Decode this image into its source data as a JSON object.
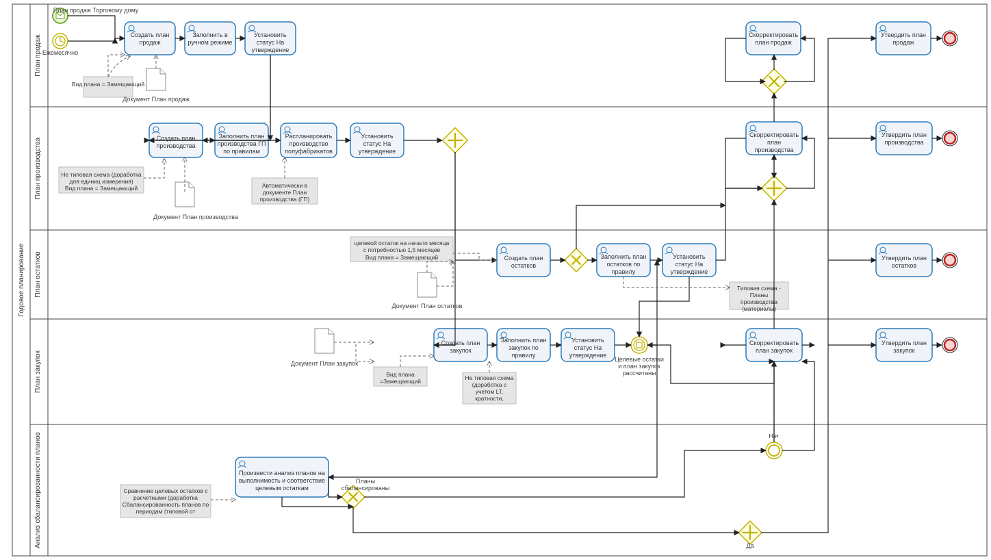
{
  "pool": {
    "title": "Годовое планирование"
  },
  "lanes": [
    {
      "id": "l1",
      "title": "План продаж"
    },
    {
      "id": "l2",
      "title": "План производства"
    },
    {
      "id": "l3",
      "title": "План остатков"
    },
    {
      "id": "l4",
      "title": "План закупок"
    },
    {
      "id": "l5",
      "title": "Анализ сбалансированности планов"
    }
  ],
  "startEvents": {
    "message": {
      "label": "План продаж Торговому дому"
    },
    "timer": {
      "label": "Ежемесячно"
    }
  },
  "tasks": {
    "t_sales_create": "Создать план продаж",
    "t_sales_fill": "Заполнить в ручном режиме",
    "t_sales_status": "Установить статус На утверждение",
    "t_sales_corr": "Скорректировать план продаж",
    "t_sales_appr": "Утвердить план продаж",
    "t_prod_create": "Создать план производства",
    "t_prod_fill": "Заполнить план производства ГП по правилам",
    "t_prod_semi": "Распланировать производство полуфабрикатов",
    "t_prod_status": "Установить статус На утверждение",
    "t_prod_corr": "Скорректировать план производства",
    "t_prod_appr": "Утвердить план производства",
    "t_stock_create": "Создать план остатков",
    "t_stock_fill": "Заполнить план остатков по правилу",
    "t_stock_status": "Установить статус На утверждение",
    "t_stock_appr": "Утвердить план остатков",
    "t_purch_create": "Создать план закупок",
    "t_purch_fill": "Заполнить план закупок по правилу",
    "t_purch_status": "Установить статус На утверждение",
    "t_purch_corr": "Скорректировать план закупок",
    "t_purch_appr": "Утвердить план закупок",
    "t_balance": "Произвести анализ планов на выполнимость и соответствие целевым остаткам"
  },
  "annotations": {
    "a_sales_type": "Вид плана = Замещающий",
    "a_sales_doc": "Документ План продаж",
    "a_prod_scheme": "Не типовая схема (доработка для единиц измерения)\nВид плана = Замещающий",
    "a_prod_doc": "Документ План производства",
    "a_prod_auto": "Автоматически в документе План производства (ГП)",
    "a_stock_top": "целевой остаток на начало месяца с потребностью 1,5 месяцев\nВид плана = Замещающий",
    "a_stock_doc": "Документ План остатков",
    "a_stock_scheme": "Типовая схема - Планы производства (материалы)",
    "a_purch_doc": "Документ План закупок",
    "a_purch_type": "Вид плана =Замещающий",
    "a_purch_scheme": "Не типовая схема (доработка с учетом LT, кратности,",
    "a_balance": "Сравнение целевых остатков с расчетными (доработка Сбалансированность планов по периодам (типовой от"
  },
  "gateways": {
    "g_prod_split": "parallel",
    "g_sales_x": "exclusive",
    "g_prod_join": "parallel",
    "g_stock_x": "exclusive",
    "g_purch_int": "intermediate",
    "g_bal_x": "exclusive",
    "g_bal_no": "inclusive",
    "g_bal_yes": "parallel"
  },
  "labels": {
    "purch_int": "Целевые остатки и план закупок рассчитаны",
    "bal_split": "Планы сбалансированы",
    "bal_no": "Нет",
    "bal_yes": "Да"
  }
}
